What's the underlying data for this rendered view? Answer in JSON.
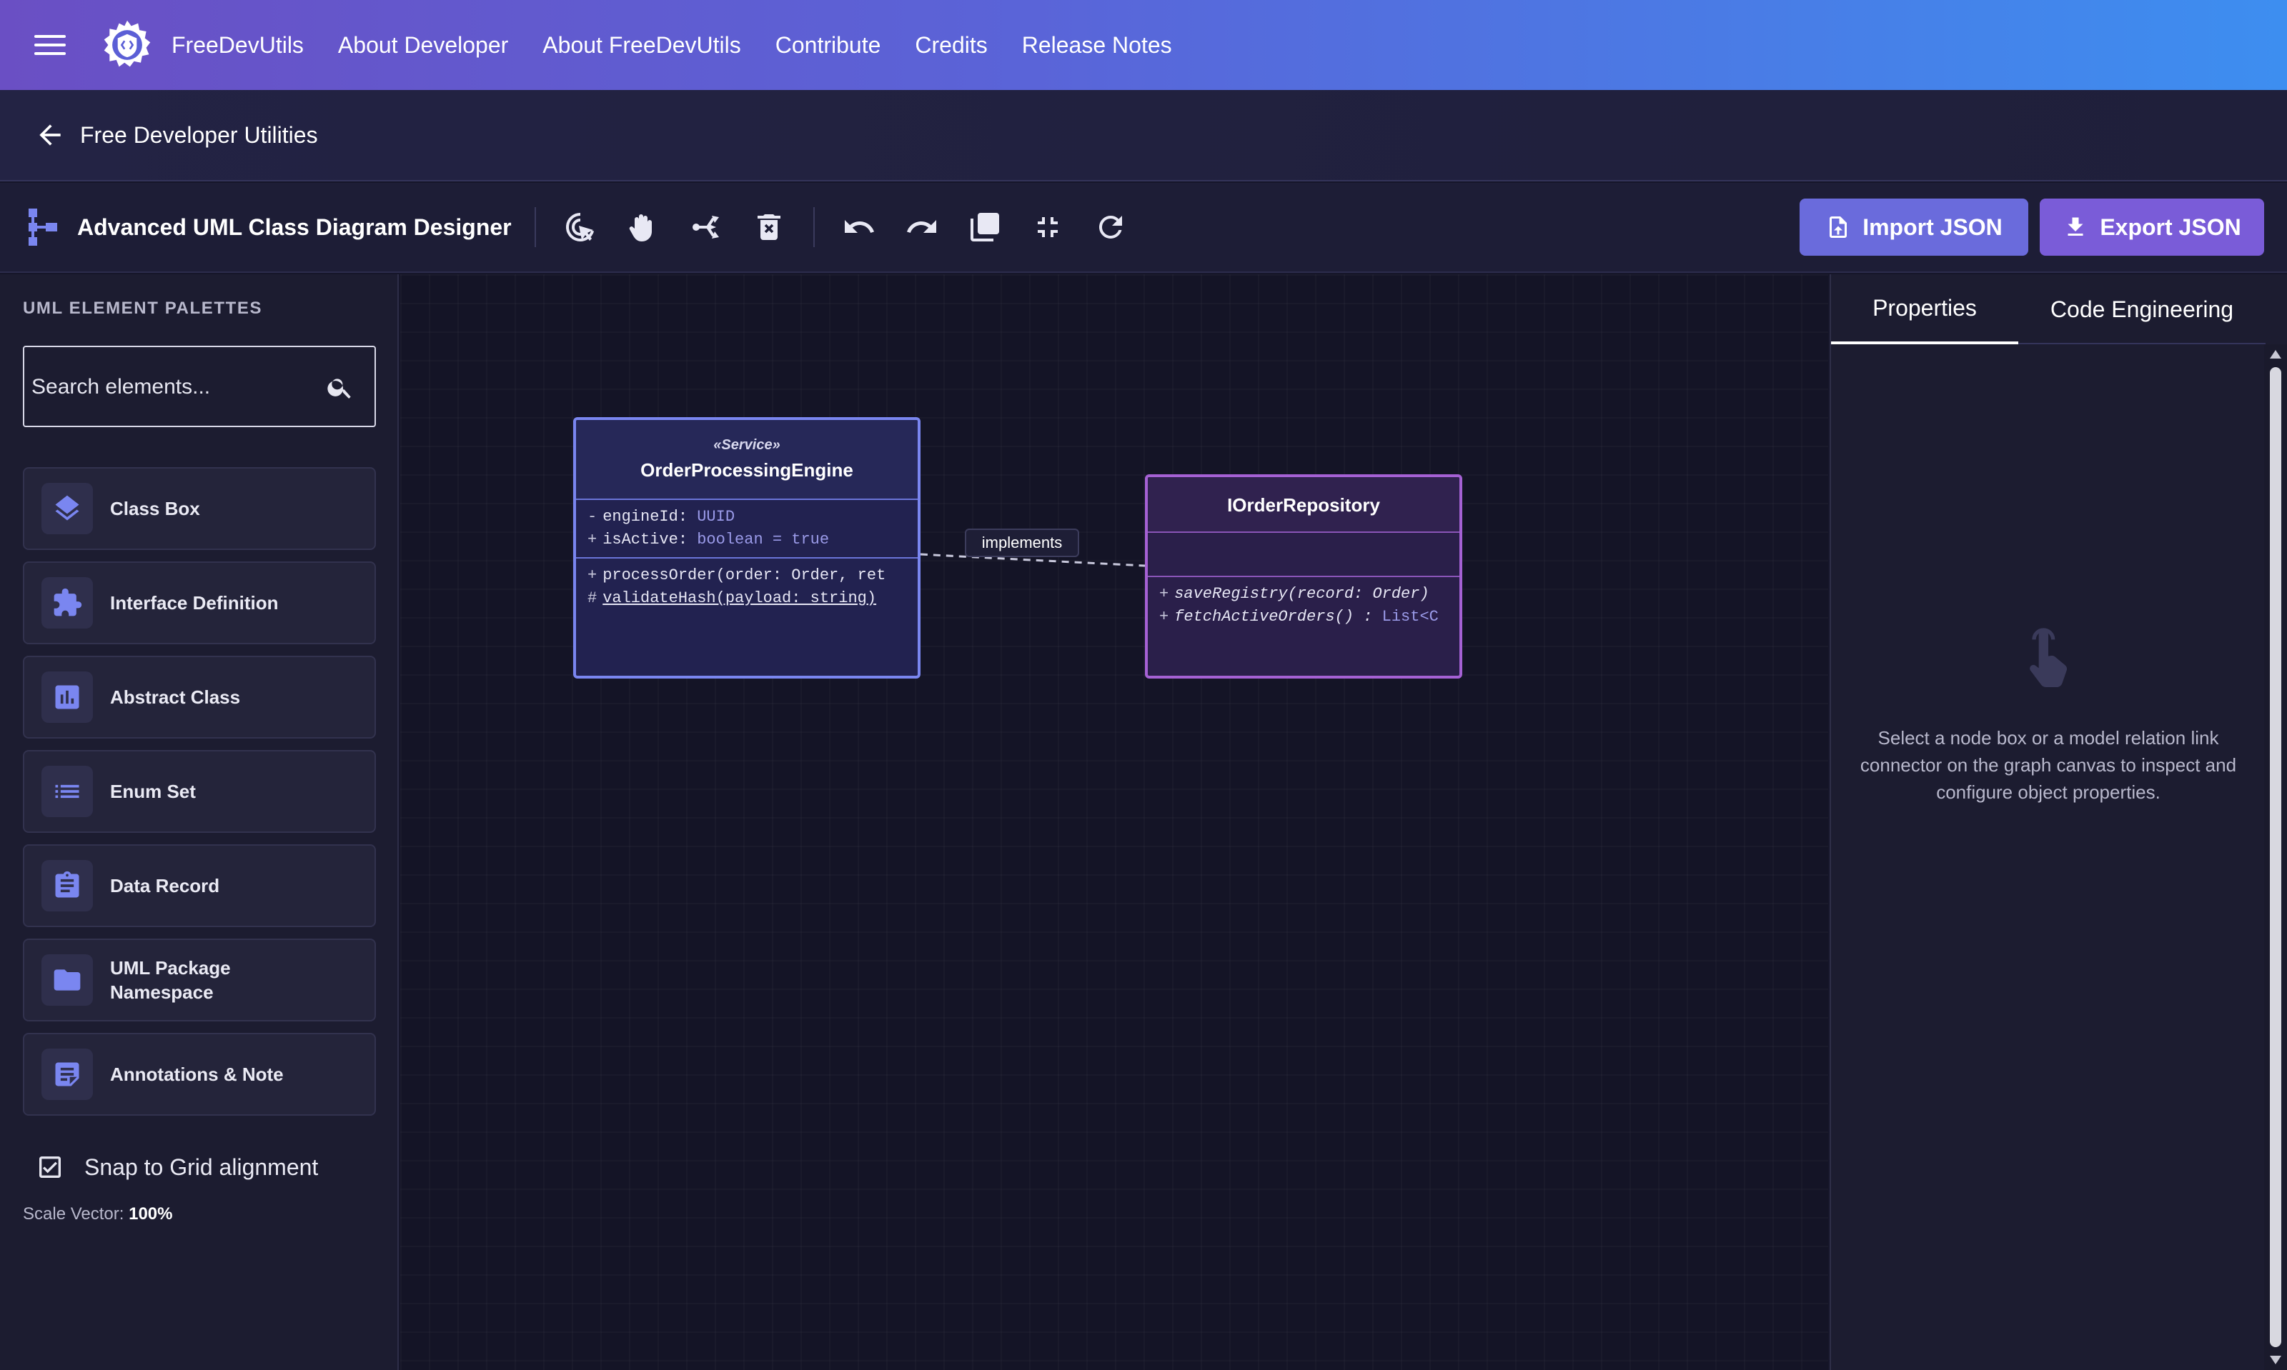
{
  "topbar": {
    "brand": "FreeDevUtils",
    "nav": [
      "About Developer",
      "About FreeDevUtils",
      "Contribute",
      "Credits",
      "Release Notes"
    ]
  },
  "breadcrumb": {
    "title": "Free Developer Utilities"
  },
  "toolbar": {
    "title": "Advanced UML Class Diagram Designer",
    "tools": [
      "select-icon",
      "pan-hand-icon",
      "connector-icon",
      "delete-icon",
      "undo-icon",
      "redo-icon",
      "duplicate-icon",
      "fit-screen-icon",
      "reset-icon"
    ],
    "import_label": "Import JSON",
    "export_label": "Export JSON"
  },
  "sidebar": {
    "heading": "UML ELEMENT PALETTES",
    "search_placeholder": "Search elements...",
    "palettes": [
      {
        "label": "Class Box",
        "icon": "layers-icon"
      },
      {
        "label": "Interface Definition",
        "icon": "puzzle-icon"
      },
      {
        "label": "Abstract Class",
        "icon": "chart-box-icon"
      },
      {
        "label": "Enum Set",
        "icon": "list-icon"
      },
      {
        "label": "Data Record",
        "icon": "clipboard-icon"
      },
      {
        "label": "UML Package Namespace",
        "icon": "folder-icon"
      },
      {
        "label": "Annotations & Note",
        "icon": "note-icon"
      }
    ],
    "snap_label": "Snap to Grid alignment",
    "snap_checked": true,
    "scale_label": "Scale Vector:",
    "scale_value": "100%"
  },
  "diagram": {
    "nodes": [
      {
        "stereotype": "«Service»",
        "name": "OrderProcessingEngine",
        "attributes": [
          {
            "vis": "-",
            "name": "engineId:",
            "type": "UUID"
          },
          {
            "vis": "+",
            "name": "isActive:",
            "type": "boolean = true"
          }
        ],
        "methods": [
          {
            "vis": "+",
            "text": "processOrder(order: Order, ret"
          },
          {
            "vis": "#",
            "text": "validateHash(payload: string)"
          }
        ]
      },
      {
        "name": "IOrderRepository",
        "methods": [
          {
            "vis": "+",
            "text": "saveRegistry(record: Order)"
          },
          {
            "vis": "+",
            "text": "fetchActiveOrders() :",
            "type": "List<C"
          }
        ]
      }
    ],
    "edge_label": "implements"
  },
  "rpanel": {
    "tabs": [
      "Properties",
      "Code Engineering"
    ],
    "empty_text": "Select a node box or a model relation link connector on the graph canvas to inspect and configure object properties."
  },
  "colors": {
    "topbar_start": "#6a4fc4",
    "topbar_end": "#3d8ef0",
    "import_btn": "#6a6bdc",
    "export_btn": "#7a5cd8",
    "node_service_border": "#7a86f0",
    "node_interface_border": "#a561d4"
  }
}
